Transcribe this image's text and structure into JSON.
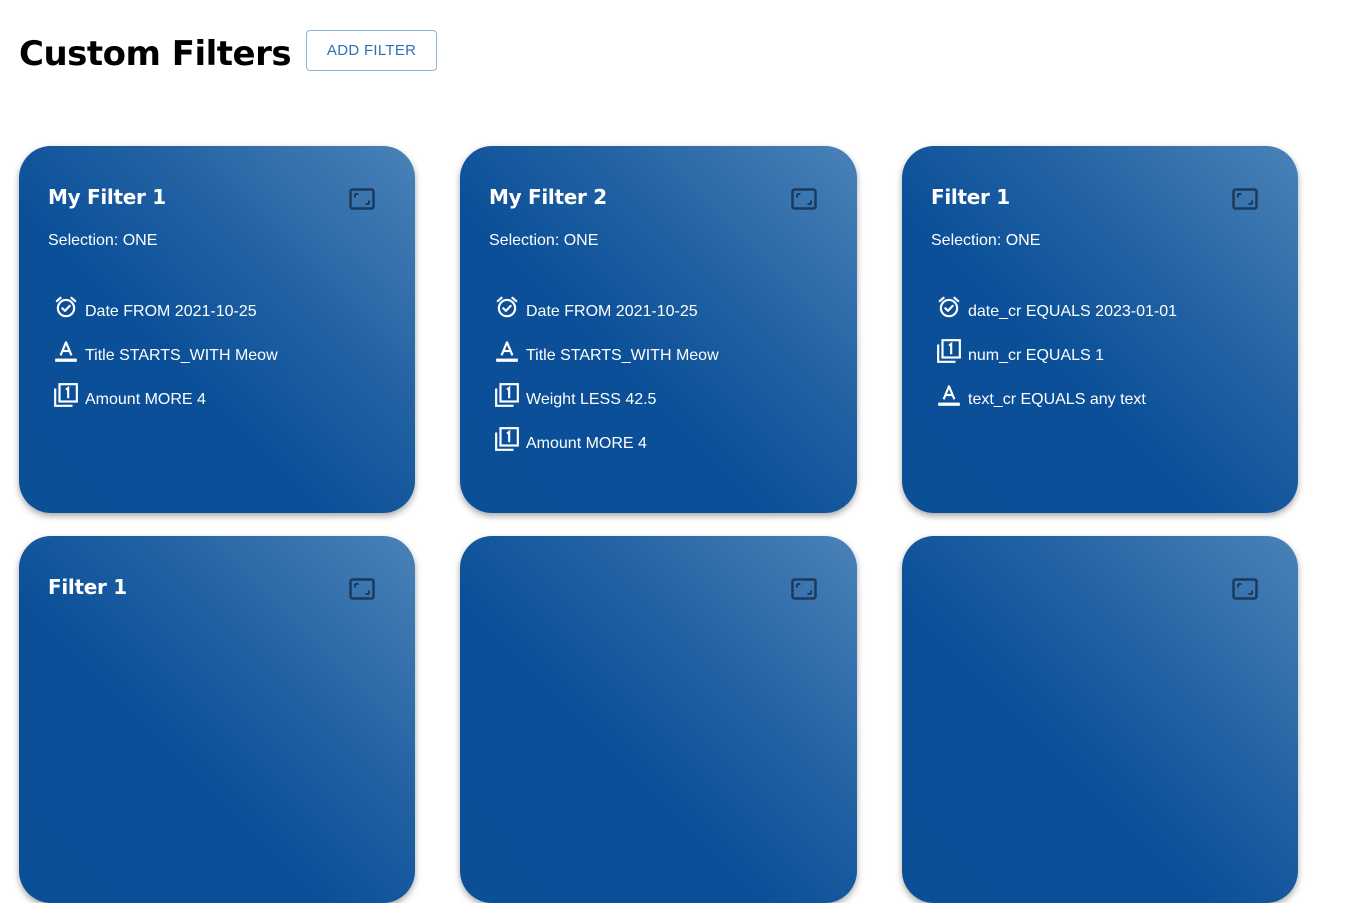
{
  "page": {
    "title": "Custom Filters",
    "add_filter_label": "ADD FILTER"
  },
  "colors": {
    "card_gradient_light": "#4a82b8",
    "card_gradient_dark": "#0b4f97",
    "button_text": "#2f6fb4",
    "icon_dark": "#1c3a5c"
  },
  "cards": [
    {
      "title": "My Filter 1",
      "selection": "Selection: ONE",
      "criteria": [
        {
          "icon": "alarm-clock-icon",
          "text": "Date FROM 2021-10-25"
        },
        {
          "icon": "text-format-icon",
          "text": "Title STARTS_WITH Meow"
        },
        {
          "icon": "number-one-icon",
          "text": "Amount MORE 4"
        }
      ]
    },
    {
      "title": "My Filter 2",
      "selection": "Selection: ONE",
      "criteria": [
        {
          "icon": "alarm-clock-icon",
          "text": "Date FROM 2021-10-25"
        },
        {
          "icon": "text-format-icon",
          "text": "Title STARTS_WITH Meow"
        },
        {
          "icon": "number-one-icon",
          "text": "Weight LESS 42.5"
        },
        {
          "icon": "number-one-icon",
          "text": "Amount MORE 4"
        }
      ]
    },
    {
      "title": "Filter 1",
      "selection": "Selection: ONE",
      "criteria": [
        {
          "icon": "alarm-clock-icon",
          "text": "date_cr EQUALS 2023-01-01"
        },
        {
          "icon": "number-one-icon",
          "text": "num_cr EQUALS 1"
        },
        {
          "icon": "text-format-icon",
          "text": "text_cr EQUALS any text"
        }
      ]
    },
    {
      "title": "Filter 1",
      "selection": "",
      "criteria": []
    },
    {
      "title": "",
      "selection": "",
      "criteria": []
    },
    {
      "title": "",
      "selection": "",
      "criteria": []
    }
  ]
}
